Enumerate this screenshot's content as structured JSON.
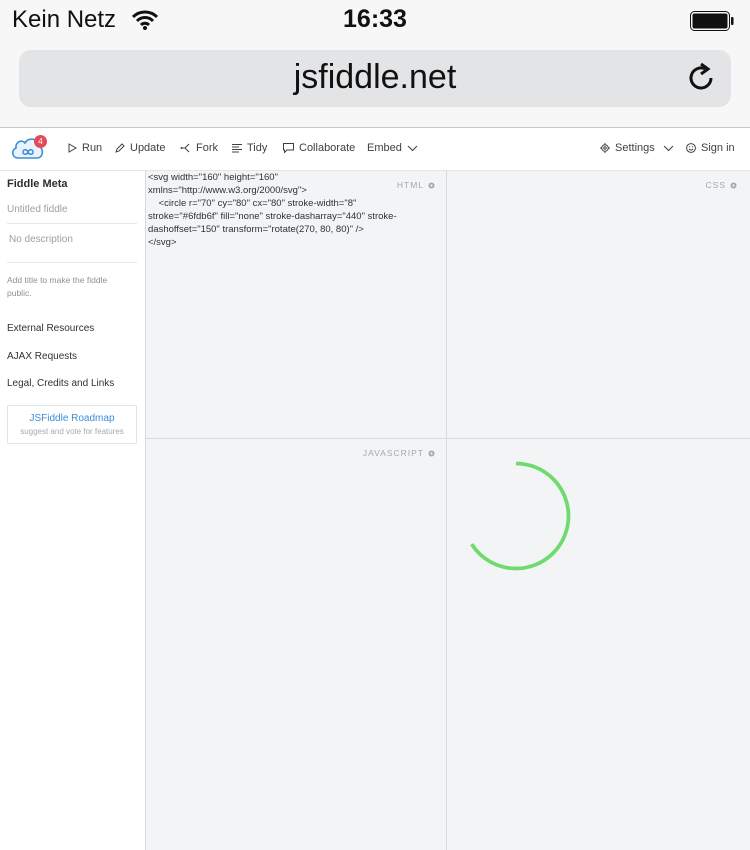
{
  "status_bar": {
    "carrier": "Kein Netz",
    "time": "16:33"
  },
  "browser": {
    "url": "jsfiddle.net"
  },
  "toolbar": {
    "notification_count": "4",
    "run": "Run",
    "update": "Update",
    "fork": "Fork",
    "tidy": "Tidy",
    "collaborate": "Collaborate",
    "embed": "Embed",
    "settings": "Settings",
    "sign_in": "Sign in"
  },
  "sidebar": {
    "title": "Fiddle Meta",
    "title_placeholder": "Untitled fiddle",
    "description_placeholder": "No description",
    "hint": "Add title to make the fiddle public.",
    "links": [
      "External Resources",
      "AJAX Requests",
      "Legal, Credits and Links"
    ],
    "roadmap_title": "JSFiddle Roadmap",
    "roadmap_sub": "suggest and vote for features"
  },
  "panes": {
    "html_label": "HTML",
    "css_label": "CSS",
    "js_label": "JAVASCRIPT",
    "html_code": "<svg width=\"160\" height=\"160\"\nxmlns=\"http://www.w3.org/2000/svg\">\n    <circle r=\"70\" cy=\"80\" cx=\"80\" stroke-width=\"8\"\nstroke=\"#6fdb6f\" fill=\"none\" stroke-dasharray=\"440\" stroke-\ndashoffset=\"150\" transform=\"rotate(270, 80, 80)\" />\n</svg>"
  },
  "colors": {
    "spinner_stroke": "#6fdb6f",
    "badge": "#e24b57",
    "link": "#3b8ed6"
  }
}
